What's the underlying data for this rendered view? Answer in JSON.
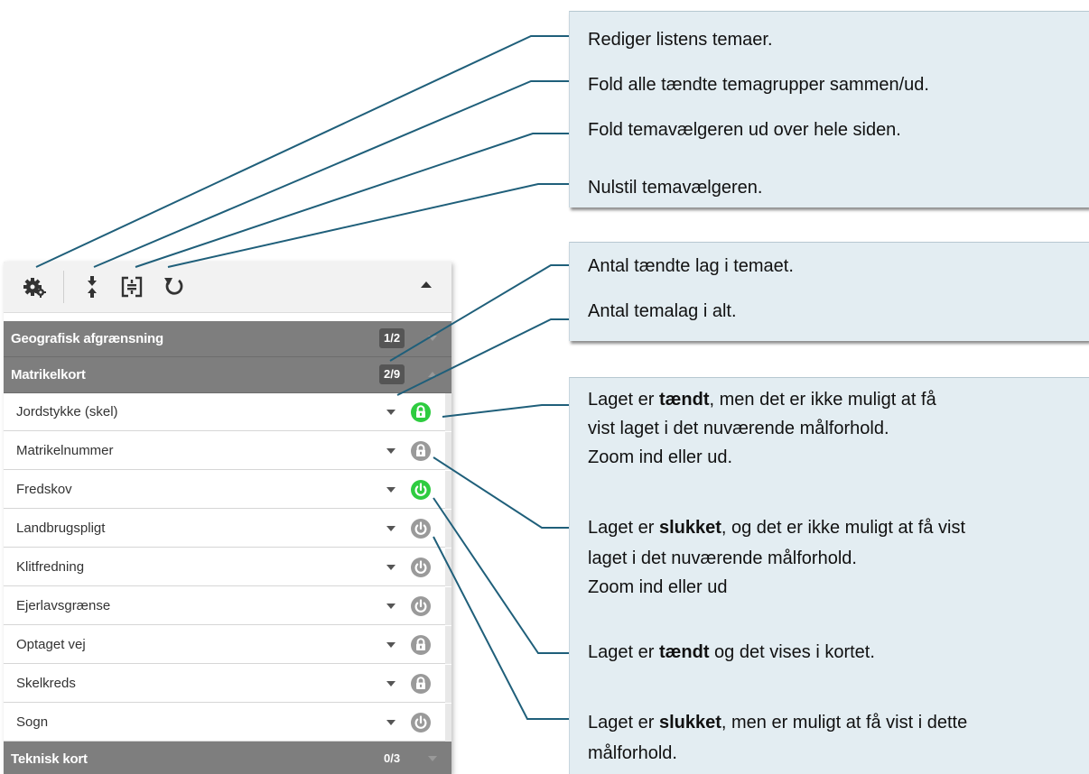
{
  "callouts": {
    "toolbar": {
      "edit_themes": "Rediger listens temaer.",
      "fold_groups": "Fold alle tændte temagrupper sammen/ud.",
      "expand_full": "Fold temavælgeren ud over hele siden.",
      "reset": "Nulstil temavælgeren."
    },
    "counts": {
      "active_layers": "Antal tændte lag i temaet.",
      "total_layers": "Antal temalag i alt."
    },
    "states": {
      "on_locked": {
        "pre": "Laget er ",
        "bold": "tændt",
        "post": ", men det er ikke muligt at få",
        "line2": "vist laget i det nuværende målforhold.",
        "line3": "Zoom ind eller ud."
      },
      "off_locked": {
        "pre": "Laget er ",
        "bold": "slukket",
        "post": ", og det er ikke muligt at få vist",
        "line2": "laget i det nuværende målforhold.",
        "line3": "Zoom ind eller ud"
      },
      "on_visible": {
        "pre": "Laget er ",
        "bold": "tændt",
        "post": " og det vises i kortet."
      },
      "off_available": {
        "pre": "Laget er ",
        "bold": "slukket",
        "post": ", men er muligt at få vist i dette",
        "line2": "målforhold."
      }
    }
  },
  "panel": {
    "groups": {
      "geografisk": {
        "label": "Geografisk afgrænsning",
        "count": "1/2"
      },
      "matrikel": {
        "label": "Matrikelkort",
        "count": "2/9"
      },
      "teknisk": {
        "label": "Teknisk kort",
        "count": "0/3"
      }
    },
    "layers": [
      {
        "label": "Jordstykke (skel)",
        "state": "on-locked"
      },
      {
        "label": "Matrikelnummer",
        "state": "off-locked"
      },
      {
        "label": "Fredskov",
        "state": "on"
      },
      {
        "label": "Landbrugspligt",
        "state": "off"
      },
      {
        "label": "Klitfredning",
        "state": "off"
      },
      {
        "label": "Ejerlavsgrænse",
        "state": "off"
      },
      {
        "label": "Optaget vej",
        "state": "off-locked"
      },
      {
        "label": "Skelkreds",
        "state": "off-locked"
      },
      {
        "label": "Sogn",
        "state": "off"
      }
    ]
  },
  "colors": {
    "callout_bg": "#e3edf2",
    "leader_line": "#1f5f7a",
    "group_bg": "#7e7e7e",
    "active_green": "#2ecc40",
    "inactive_grey": "#9a9a9a"
  },
  "icons": [
    "gear-icon",
    "fold-vertical-icon",
    "expand-frame-icon",
    "reset-icon",
    "lock-icon",
    "power-icon"
  ]
}
